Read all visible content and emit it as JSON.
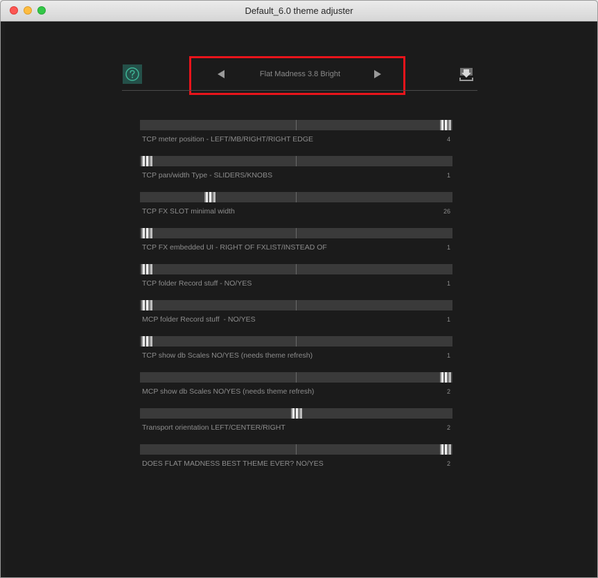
{
  "window": {
    "title": "Default_6.0 theme adjuster"
  },
  "header": {
    "help_icon": "question-circle-icon",
    "save_icon": "download-icon",
    "prev_icon": "triangle-left-icon",
    "next_icon": "triangle-right-icon",
    "theme_name": "Flat Madness 3.8 Bright",
    "highlight_color": "#e9141b"
  },
  "sliders": [
    {
      "label": "TCP meter position - LEFT/MB/RIGHT/RIGHT EDGE",
      "value": "4",
      "position": 1.0
    },
    {
      "label": "TCP pan/width Type - SLIDERS/KNOBS",
      "value": "1",
      "position": 0.0
    },
    {
      "label": "TCP FX SLOT minimal width",
      "value": "26",
      "position": 0.21
    },
    {
      "label": "TCP FX embedded UI - RIGHT OF FXLIST/INSTEAD OF",
      "value": "1",
      "position": 0.0
    },
    {
      "label": "TCP folder Record stuff - NO/YES",
      "value": "1",
      "position": 0.0
    },
    {
      "label": "MCP folder Record stuff  - NO/YES",
      "value": "1",
      "position": 0.0
    },
    {
      "label": "TCP show db Scales NO/YES (needs theme refresh)",
      "value": "1",
      "position": 0.0
    },
    {
      "label": "MCP show db Scales NO/YES (needs theme refresh)",
      "value": "2",
      "position": 1.0
    },
    {
      "label": "Transport orientation LEFT/CENTER/RIGHT",
      "value": "2",
      "position": 0.5
    },
    {
      "label": "DOES FLAT MADNESS BEST THEME EVER? NO/YES",
      "value": "2",
      "position": 1.0
    }
  ]
}
